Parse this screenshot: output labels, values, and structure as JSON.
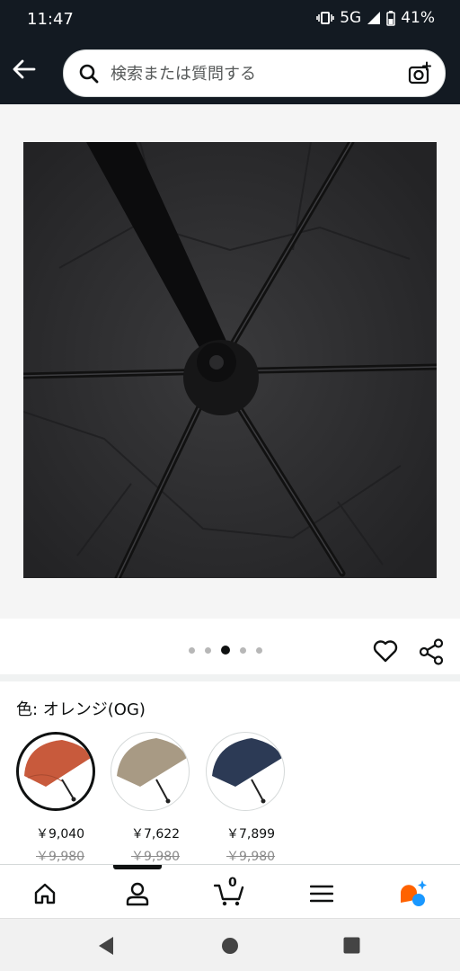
{
  "status_bar": {
    "time": "11:47",
    "network": "5G",
    "battery": "41%"
  },
  "search": {
    "placeholder": "検索または質問する"
  },
  "carousel": {
    "total": 5,
    "active_index": 2
  },
  "product": {
    "color_label": "色: オレンジ(OG)",
    "variants": [
      {
        "color": "#c85a3c",
        "price": "￥9,040",
        "list_price": "￥9,980",
        "selected": true
      },
      {
        "color": "#a89a84",
        "price": "￥7,622",
        "list_price": "￥9,980",
        "selected": false
      },
      {
        "color": "#2c3a55",
        "price": "￥7,899",
        "list_price": "￥9,980",
        "selected": false
      }
    ]
  },
  "cart": {
    "count": "0"
  },
  "colors": {
    "header_bg": "#131a22",
    "text": "#0f1111",
    "rufus_orange": "#ff6200",
    "rufus_blue": "#1a98ff"
  },
  "icons": [
    "back-arrow-icon",
    "search-icon",
    "camera-icon",
    "heart-icon",
    "share-icon",
    "home-icon",
    "account-icon",
    "cart-icon",
    "menu-icon",
    "rufus-icon",
    "system-back-icon",
    "system-home-icon",
    "system-recents-icon"
  ]
}
